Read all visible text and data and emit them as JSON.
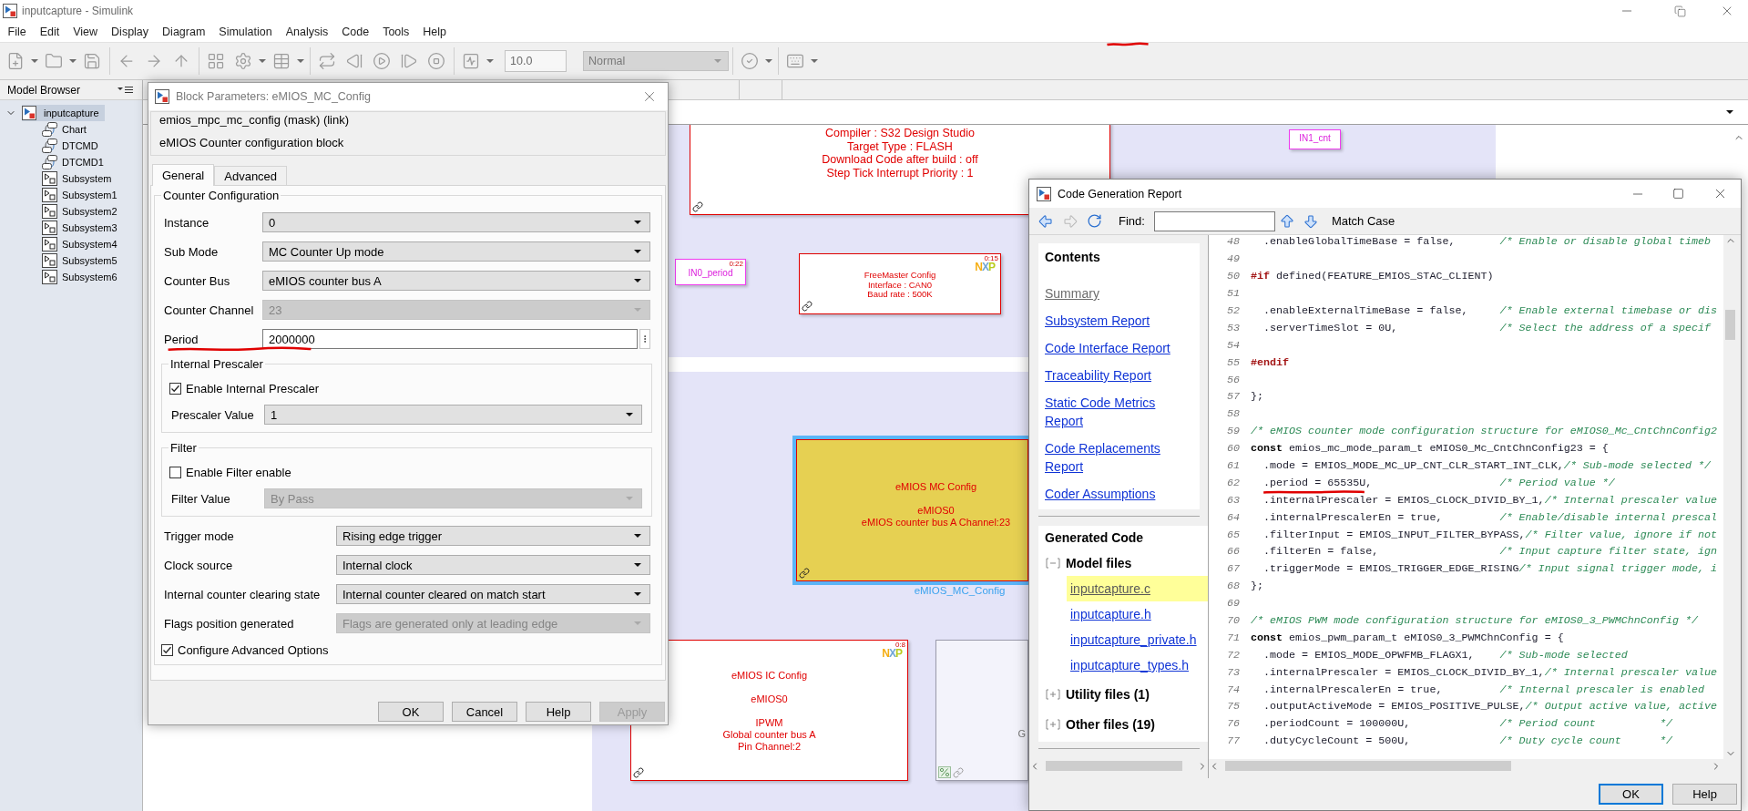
{
  "window": {
    "title": "inputcapture - Simulink"
  },
  "menu": [
    "File",
    "Edit",
    "View",
    "Display",
    "Diagram",
    "Simulation",
    "Analysis",
    "Code",
    "Tools",
    "Help"
  ],
  "toolbar": {
    "stop_time": "10.0",
    "mode": {
      "value": "Normal",
      "disabled": true
    }
  },
  "model_browser": {
    "title": "Model Browser",
    "tree": [
      {
        "label": "inputcapture",
        "kind": "model",
        "expanded": true,
        "selected": true,
        "children": [
          {
            "label": "Chart",
            "kind": "chart",
            "selected": false
          },
          {
            "label": "DTCMD",
            "kind": "chart",
            "selected": false
          },
          {
            "label": "DTCMD1",
            "kind": "chart",
            "selected": false
          },
          {
            "label": "Subsystem",
            "kind": "subsystem",
            "selected": false
          },
          {
            "label": "Subsystem1",
            "kind": "subsystem",
            "selected": false
          },
          {
            "label": "Subsystem2",
            "kind": "subsystem",
            "selected": false
          },
          {
            "label": "Subsystem3",
            "kind": "subsystem",
            "selected": false
          },
          {
            "label": "Subsystem4",
            "kind": "subsystem",
            "selected": false
          },
          {
            "label": "Subsystem5",
            "kind": "subsystem",
            "selected": false
          },
          {
            "label": "Subsystem6",
            "kind": "subsystem",
            "selected": false
          }
        ]
      }
    ]
  },
  "canvas": {
    "blocks": [
      {
        "kind": "info",
        "color": "#ffffff",
        "selected": false,
        "linked": true,
        "paragraphs": [
          [
            "Compiler : S32 Design Studio",
            "Target Type : FLASH",
            "Download Code after build : off",
            "Step Tick Interrupt Priority : 1"
          ]
        ]
      },
      {
        "kind": "port",
        "color": "#ffffff",
        "selected": false,
        "linked": false,
        "paragraphs": [
          [
            "IN1_cnt"
          ]
        ]
      },
      {
        "kind": "port",
        "color": "#ffffff",
        "selected": false,
        "linked": false,
        "corner_label": "0:22",
        "paragraphs": [
          [
            "IN0_period"
          ]
        ]
      },
      {
        "kind": "config",
        "color": "#ffffff",
        "selected": false,
        "linked": true,
        "logo": "NXP",
        "corner_label": "0:15",
        "paragraphs": [
          [
            "FreeMaster Config",
            "Interface : CAN0",
            "Baud rate : 500K"
          ]
        ]
      },
      {
        "kind": "config",
        "color": "#e6d052",
        "selected": true,
        "linked": true,
        "name": "eMIOS_MC_Config",
        "paragraphs": [
          [
            "eMIOS MC Config"
          ],
          [
            "eMIOS0",
            "eMIOS counter bus A Channel:23"
          ]
        ]
      },
      {
        "kind": "config",
        "color": "#ffffff",
        "selected": false,
        "linked": true,
        "logo": "NXP",
        "corner_label": "0:8",
        "paragraphs": [
          [
            "eMIOS IC Config"
          ],
          [
            "eMIOS0"
          ],
          [
            "IPWM",
            "Global counter bus A",
            "Pin Channel:2"
          ]
        ]
      },
      {
        "kind": "subsystem",
        "color": "#f3f3fb",
        "selected": false,
        "linked": true,
        "paragraphs": [
          [
            "G"
          ]
        ]
      }
    ]
  },
  "block_parameters": {
    "title": "Block Parameters: eMIOS_MC_Config",
    "mask_type": "emios_mpc_mc_config (mask) (link)",
    "description": "eMIOS Counter configuration block",
    "tabs": [
      {
        "label": "General",
        "selected": true
      },
      {
        "label": "Advanced",
        "selected": false
      }
    ],
    "group": {
      "title": "Counter Configuration",
      "fields": [
        {
          "kind": "select",
          "label": "Instance",
          "value": "0",
          "disabled": false
        },
        {
          "kind": "select",
          "label": "Sub Mode",
          "value": "MC Counter Up mode",
          "disabled": false
        },
        {
          "kind": "select",
          "label": "Counter Bus",
          "value": "eMIOS counter bus A",
          "disabled": false
        },
        {
          "kind": "select",
          "label": "Counter Channel",
          "value": "23",
          "disabled": true
        },
        {
          "kind": "text",
          "label": "Period",
          "value": "2000000"
        }
      ],
      "subgroups": [
        {
          "title": "Internal Prescaler",
          "checkbox": {
            "label": "Enable Internal Prescaler",
            "checked": true
          },
          "field": {
            "label": "Prescaler Value",
            "value": "1",
            "disabled": false
          }
        },
        {
          "title": "Filter",
          "checkbox": {
            "label": "Enable Filter enable",
            "checked": false
          },
          "field": {
            "label": "Filter Value",
            "value": "By Pass",
            "disabled": true
          }
        }
      ],
      "options": [
        {
          "label": "Trigger mode",
          "value": "Rising edge trigger",
          "disabled": false
        },
        {
          "label": "Clock source",
          "value": "Internal clock",
          "disabled": false
        },
        {
          "label": "Internal counter clearing state",
          "value": "Internal counter cleared on match start",
          "disabled": false
        },
        {
          "label": "Flags position generated",
          "value": "Flags are generated only at leading edge",
          "disabled": true
        }
      ],
      "advanced": {
        "label": "Configure Advanced Options",
        "checked": true
      }
    },
    "buttons": [
      {
        "label": "OK",
        "disabled": false
      },
      {
        "label": "Cancel",
        "disabled": false
      },
      {
        "label": "Help",
        "disabled": false
      },
      {
        "label": "Apply",
        "disabled": true
      }
    ]
  },
  "code_report": {
    "title": "Code Generation Report",
    "find_label": "Find:",
    "match_case": "Match Case",
    "contents": {
      "title": "Contents",
      "links": [
        {
          "label": "Summary",
          "visited": true
        },
        {
          "label": "Subsystem Report",
          "visited": false
        },
        {
          "label": "Code Interface Report",
          "visited": false
        },
        {
          "label": "Traceability Report",
          "visited": false
        },
        {
          "label": "Static Code Metrics Report",
          "visited": false
        },
        {
          "label": "Code Replacements Report",
          "visited": false
        },
        {
          "label": "Coder Assumptions",
          "visited": false
        }
      ]
    },
    "generated_code": {
      "title": "Generated Code",
      "groups": [
        {
          "label": "Model files",
          "expanded": true,
          "files": [
            {
              "name": "inputcapture.c",
              "selected": true
            },
            {
              "name": "inputcapture.h",
              "selected": false
            },
            {
              "name": "inputcapture_private.h",
              "selected": false
            },
            {
              "name": "inputcapture_types.h",
              "selected": false
            }
          ]
        },
        {
          "label": "Utility files (1)",
          "expanded": false
        },
        {
          "label": "Other files (19)",
          "expanded": false
        }
      ]
    },
    "code_lines": [
      {
        "number": "48",
        "parts": [
          {
            "kind": "code",
            "text": "  .enableGlobalTimeBase = false,       "
          },
          {
            "kind": "comment",
            "text": "/* Enable or disable global timeb"
          }
        ]
      },
      {
        "number": "49"
      },
      {
        "number": "50",
        "parts": [
          {
            "kind": "directive",
            "text": "#if"
          },
          {
            "kind": "code",
            "text": " defined(FEATURE_EMIOS_STAC_CLIENT)"
          }
        ]
      },
      {
        "number": "51"
      },
      {
        "number": "52",
        "parts": [
          {
            "kind": "code",
            "text": "  .enableExternalTimeBase = false,     "
          },
          {
            "kind": "comment",
            "text": "/* Enable external timebase or dis"
          }
        ]
      },
      {
        "number": "53",
        "parts": [
          {
            "kind": "code",
            "text": "  .serverTimeSlot = 0U,                "
          },
          {
            "kind": "comment",
            "text": "/* Select the address of a specif"
          }
        ]
      },
      {
        "number": "54"
      },
      {
        "number": "55",
        "parts": [
          {
            "kind": "directive",
            "text": "#endif"
          }
        ]
      },
      {
        "number": "56"
      },
      {
        "number": "57",
        "parts": [
          {
            "kind": "code",
            "text": "};"
          }
        ]
      },
      {
        "number": "58"
      },
      {
        "number": "59",
        "parts": [
          {
            "kind": "comment",
            "text": "/* eMIOS counter mode configuration structure for eMIOS0_Mc_CntChnConfig2"
          }
        ]
      },
      {
        "number": "60",
        "parts": [
          {
            "kind": "keyword",
            "text": "const"
          },
          {
            "kind": "code",
            "text": " emios_mc_mode_param_t eMIOS0_Mc_CntChnConfig23 = {"
          }
        ]
      },
      {
        "number": "61",
        "parts": [
          {
            "kind": "code",
            "text": "  .mode = EMIOS_MODE_MC_UP_CNT_CLR_START_INT_CLK,"
          },
          {
            "kind": "comment",
            "text": "/* Sub-mode selected */"
          }
        ]
      },
      {
        "number": "62",
        "parts": [
          {
            "kind": "code",
            "text": "  .period = 65535U,                    "
          },
          {
            "kind": "comment",
            "text": "/* Period value */"
          }
        ]
      },
      {
        "number": "63",
        "parts": [
          {
            "kind": "code",
            "text": "  .internalPrescaler = EMIOS_CLOCK_DIVID_BY_1,"
          },
          {
            "kind": "comment",
            "text": "/* Internal prescaler value"
          }
        ]
      },
      {
        "number": "64",
        "parts": [
          {
            "kind": "code",
            "text": "  .internalPrescalerEn = true,         "
          },
          {
            "kind": "comment",
            "text": "/* Enable/disable internal prescal"
          }
        ]
      },
      {
        "number": "65",
        "parts": [
          {
            "kind": "code",
            "text": "  .filterInput = EMIOS_INPUT_FILTER_BYPASS,"
          },
          {
            "kind": "comment",
            "text": "/* Filter value, ignore if not"
          }
        ]
      },
      {
        "number": "66",
        "parts": [
          {
            "kind": "code",
            "text": "  .filterEn = false,                   "
          },
          {
            "kind": "comment",
            "text": "/* Input capture filter state, ign"
          }
        ]
      },
      {
        "number": "67",
        "parts": [
          {
            "kind": "code",
            "text": "  .triggerMode = EMIOS_TRIGGER_EDGE_RISING"
          },
          {
            "kind": "comment",
            "text": "/* Input signal trigger mode, i"
          }
        ]
      },
      {
        "number": "68",
        "parts": [
          {
            "kind": "code",
            "text": "};"
          }
        ]
      },
      {
        "number": "69"
      },
      {
        "number": "70",
        "parts": [
          {
            "kind": "comment",
            "text": "/* eMIOS PWM mode configuration structure for eMIOS0_3_PWMChnConfig */"
          }
        ]
      },
      {
        "number": "71",
        "parts": [
          {
            "kind": "keyword",
            "text": "const"
          },
          {
            "kind": "code",
            "text": " emios_pwm_param_t eMIOS0_3_PWMChnConfig = {"
          }
        ]
      },
      {
        "number": "72",
        "parts": [
          {
            "kind": "code",
            "text": "  .mode = EMIOS_MODE_OPWFMB_FLAGX1,    "
          },
          {
            "kind": "comment",
            "text": "/* Sub-mode selected"
          }
        ]
      },
      {
        "number": "73",
        "parts": [
          {
            "kind": "code",
            "text": "  .internalPrescaler = EMIOS_CLOCK_DIVID_BY_1,"
          },
          {
            "kind": "comment",
            "text": "/* Internal prescaler value"
          }
        ]
      },
      {
        "number": "74",
        "parts": [
          {
            "kind": "code",
            "text": "  .internalPrescalerEn = true,         "
          },
          {
            "kind": "comment",
            "text": "/* Internal prescaler is enabled"
          }
        ]
      },
      {
        "number": "75",
        "parts": [
          {
            "kind": "code",
            "text": "  .outputActiveMode = EMIOS_POSITIVE_PULSE,"
          },
          {
            "kind": "comment",
            "text": "/* Output active value, active"
          }
        ]
      },
      {
        "number": "76",
        "parts": [
          {
            "kind": "code",
            "text": "  .periodCount = 100000U,              "
          },
          {
            "kind": "comment",
            "text": "/* Period count          */"
          }
        ]
      },
      {
        "number": "77",
        "parts": [
          {
            "kind": "code",
            "text": "  .dutyCycleCount = 500U,              "
          },
          {
            "kind": "comment",
            "text": "/* Duty cycle count      */"
          }
        ]
      }
    ],
    "buttons": [
      {
        "label": "OK",
        "default": true
      },
      {
        "label": "Help",
        "default": false
      }
    ]
  }
}
